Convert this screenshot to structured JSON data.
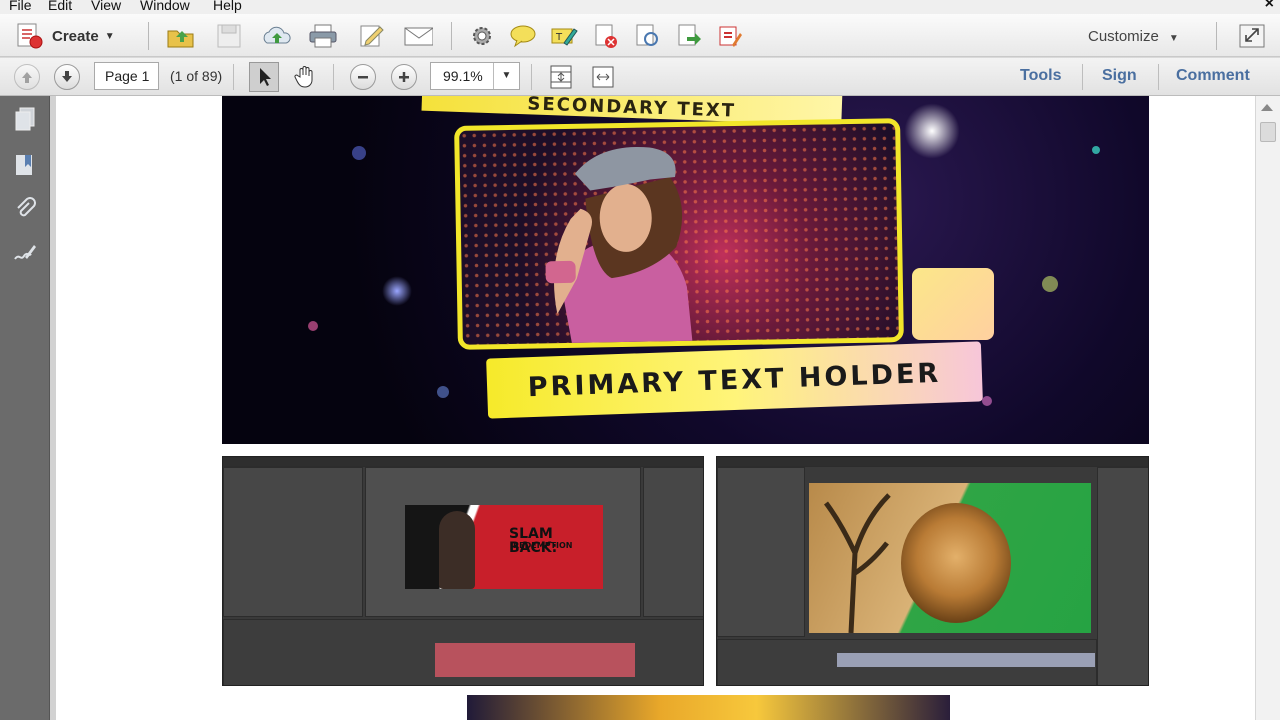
{
  "menu": {
    "file": "File",
    "edit": "Edit",
    "view": "View",
    "window": "Window",
    "help": "Help",
    "close": "×"
  },
  "toolbar": {
    "create_label": "Create",
    "customize_label": "Customize"
  },
  "nav": {
    "page_value": "Page 1",
    "page_count": "(1 of 89)",
    "zoom_value": "99.1%"
  },
  "panels": {
    "tools": "Tools",
    "sign": "Sign",
    "comment": "Comment"
  },
  "document": {
    "hero": {
      "secondary_text": "SECONDARY TEXT",
      "primary_text": "PRIMARY TEXT HOLDER"
    },
    "shot1": {
      "title_line1": "SLAM BACK:",
      "title_line2": "REDEMPTION"
    }
  },
  "colors": {
    "link": "#4a6fa0",
    "banner_yellow": "#f6ea2a",
    "green_screen": "#26a343",
    "timeline_red": "#b8525d"
  }
}
